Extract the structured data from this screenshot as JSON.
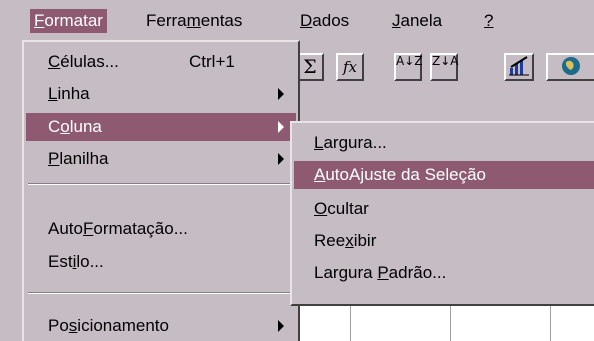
{
  "menubar": {
    "items": [
      {
        "label_u": "F",
        "label_rest": "ormatar"
      },
      {
        "label_pre": "Ferra",
        "label_u": "m",
        "label_rest": "entas"
      },
      {
        "label_u": "D",
        "label_rest": "ados"
      },
      {
        "label_u": "J",
        "label_rest": "anela"
      },
      {
        "label_u": "?",
        "label_rest": ""
      }
    ]
  },
  "toolbar": {
    "sum_glyph": "Σ",
    "fx_glyph": "fx",
    "sort_asc_glyph": "A↓Z",
    "sort_desc_glyph": "Z↓A",
    "chart_icon": "chart-wizard-icon",
    "map_icon": "map-icon"
  },
  "format_menu": {
    "items": [
      {
        "pre": "",
        "u": "C",
        "rest": "élulas...",
        "shortcut": "Ctrl+1"
      },
      {
        "pre": "",
        "u": "L",
        "rest": "inha"
      },
      {
        "pre": "C",
        "u": "o",
        "rest": "luna"
      },
      {
        "pre": "",
        "u": "P",
        "rest": "lanilha"
      },
      {
        "pre": "Auto",
        "u": "F",
        "rest": "ormatação..."
      },
      {
        "pre": "Est",
        "u": "i",
        "rest": "lo..."
      },
      {
        "pre": "Po",
        "u": "s",
        "rest": "icionamento"
      }
    ]
  },
  "column_submenu": {
    "items": [
      {
        "pre": "",
        "u": "L",
        "rest": "argura..."
      },
      {
        "pre": "",
        "u": "A",
        "rest": "utoAjuste da Seleção"
      },
      {
        "pre": "",
        "u": "O",
        "rest": "cultar"
      },
      {
        "pre": "Ree",
        "u": "x",
        "rest": "ibir"
      },
      {
        "pre": "Largura ",
        "u": "P",
        "rest": "adrão..."
      }
    ]
  },
  "colors": {
    "menu_bg": "#c6bcc4",
    "highlight": "#8e5a72",
    "highlight_text": "#ffffff"
  }
}
